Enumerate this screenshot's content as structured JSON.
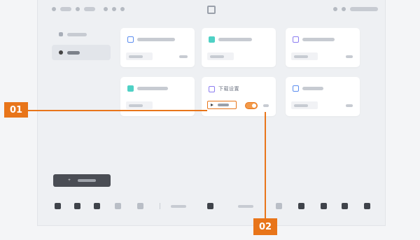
{
  "statusbar": {
    "left_text": [
      "",
      "",
      "",
      ""
    ]
  },
  "sidebar": {
    "items": [
      {
        "label": "",
        "active": false
      },
      {
        "label": "",
        "active": true
      }
    ]
  },
  "cards": [
    {
      "title": "",
      "icon": "blue-square-icon",
      "chip": "",
      "right": ""
    },
    {
      "title": "",
      "icon": "teal-square-icon",
      "chip": "",
      "right": ""
    },
    {
      "title": "",
      "icon": "purple-square-icon",
      "chip": "",
      "right": ""
    },
    {
      "title": "",
      "icon": "teal-square-icon",
      "chip": "",
      "right": ""
    },
    {
      "title": "下载设置",
      "icon": "purple-square-icon",
      "chip": "",
      "right": ""
    },
    {
      "title": "",
      "icon": "blue-square-icon",
      "chip": "",
      "right": ""
    }
  ],
  "add_button": {
    "label": ""
  },
  "dock": {
    "time_left": "",
    "time_right": ""
  },
  "callouts": {
    "first": "01",
    "second": "02"
  },
  "colors": {
    "accent": "#e8751a",
    "background": "#eef0f3"
  }
}
